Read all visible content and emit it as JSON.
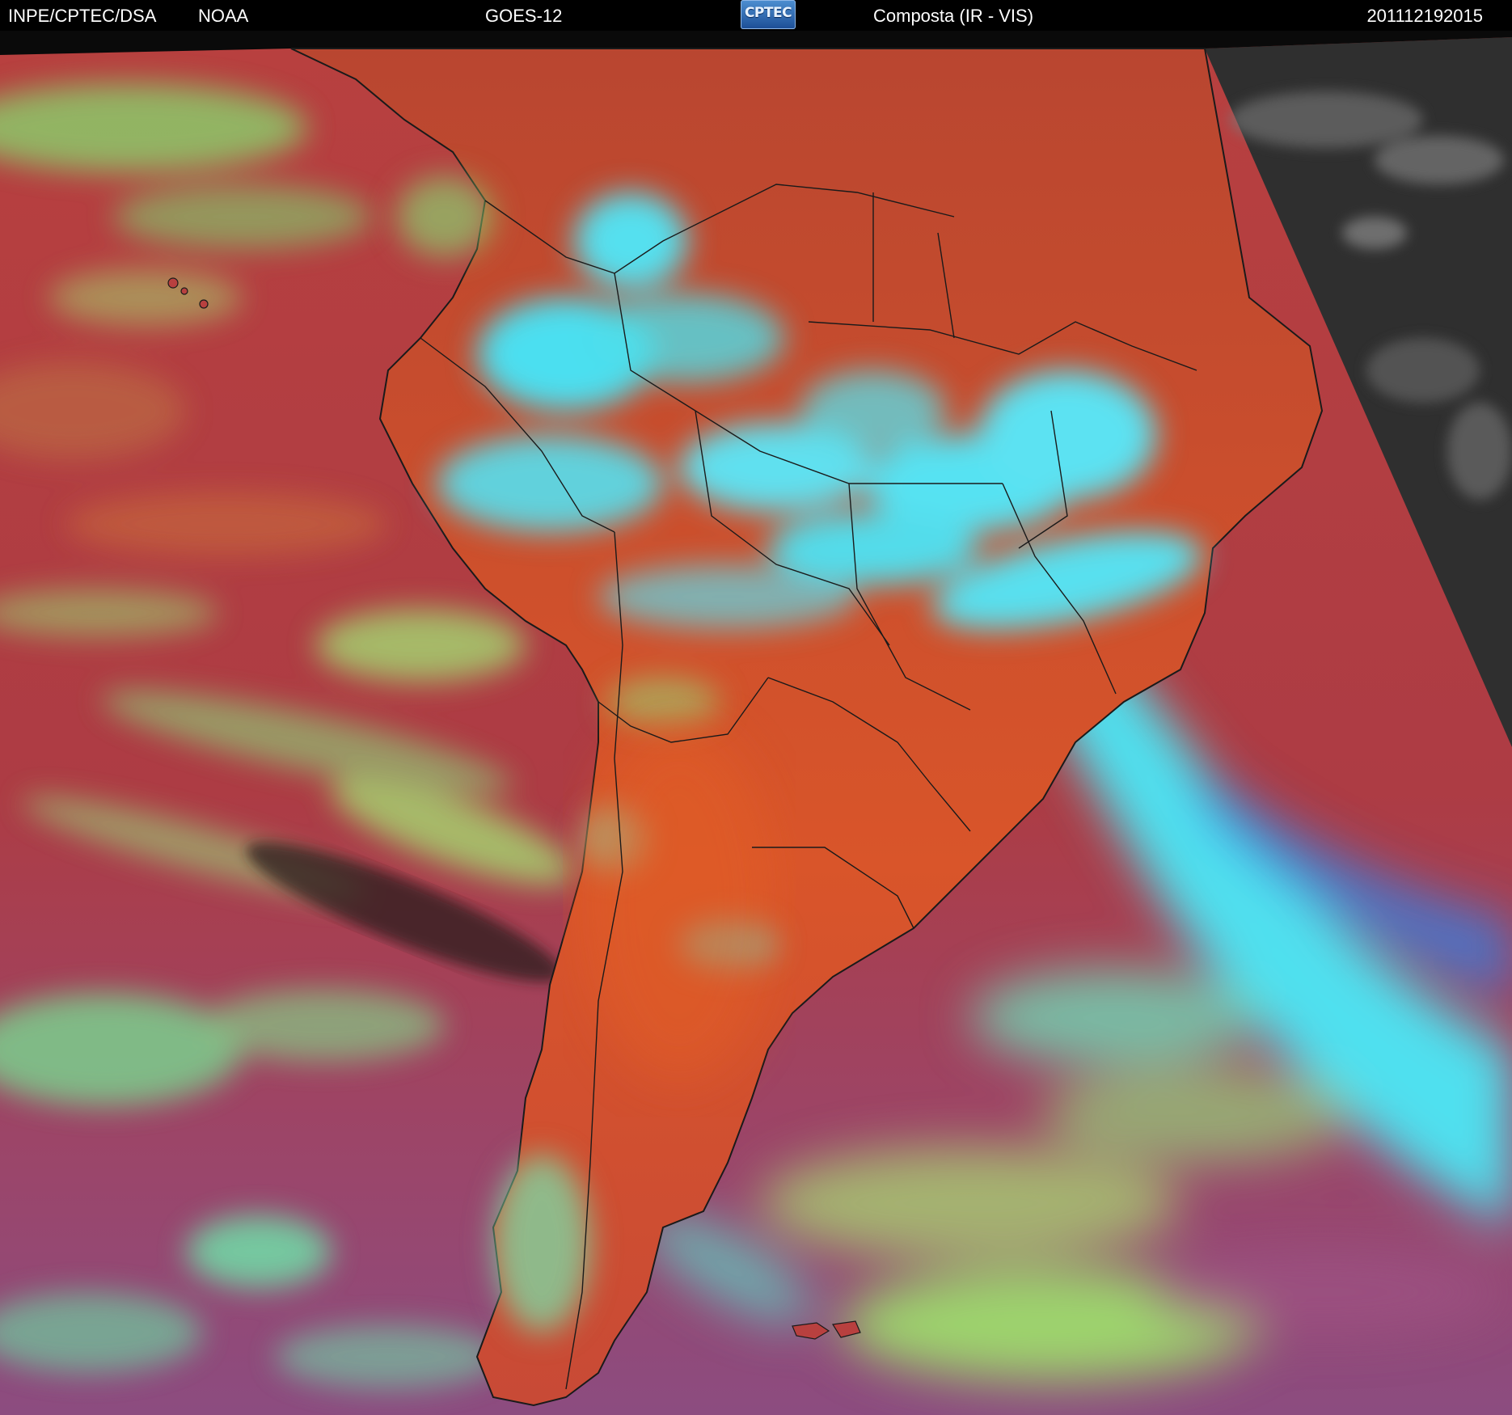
{
  "header": {
    "source_left": "INPE/CPTEC/DSA",
    "source_right": "NOAA",
    "satellite": "GOES-12",
    "logo_text": "CPTEC",
    "product": "Composta (IR - VIS)",
    "timestamp": "201112192015"
  },
  "colors": {
    "ocean_red": "#b8403f",
    "land_orange": "#d9562a",
    "cloud_cyan": "#42e0f0",
    "cloud_green": "#9ad56e",
    "magenta_south": "#9a4a78",
    "night_side": "#2e2e2e",
    "borders": "#1a1a1a"
  }
}
